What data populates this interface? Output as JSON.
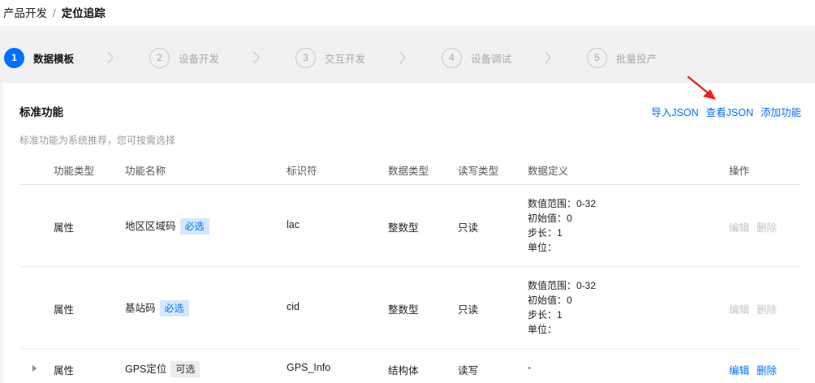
{
  "breadcrumb": {
    "parent": "产品开发",
    "separator": "/",
    "current": "定位追踪"
  },
  "steps": [
    {
      "number": "1",
      "label": "数据模板",
      "active": true
    },
    {
      "number": "2",
      "label": "设备开发",
      "active": false
    },
    {
      "number": "3",
      "label": "交互开发",
      "active": false
    },
    {
      "number": "4",
      "label": "设备调试",
      "active": false
    },
    {
      "number": "5",
      "label": "批量投产",
      "active": false
    }
  ],
  "panel": {
    "title": "标准功能",
    "description": "标准功能为系统推荐，您可按需选择",
    "actions": {
      "import_json": "导入JSON",
      "view_json": "查看JSON",
      "add_function": "添加功能"
    }
  },
  "table": {
    "headers": {
      "type": "功能类型",
      "name": "功能名称",
      "identifier": "标识符",
      "data_type": "数据类型",
      "rw_type": "读写类型",
      "definition": "数据定义",
      "operation": "操作"
    },
    "rows": [
      {
        "type": "属性",
        "name": "地区区域码",
        "tag": "必选",
        "identifier": "lac",
        "data_type": "整数型",
        "rw_type": "只读",
        "definition": [
          "数值范围：0-32",
          "初始值：0",
          "步长：1",
          "单位："
        ],
        "edit": "编辑",
        "delete": "删除"
      },
      {
        "type": "属性",
        "name": "基站码",
        "tag": "必选",
        "identifier": "cid",
        "data_type": "整数型",
        "rw_type": "只读",
        "definition": [
          "数值范围：0-32",
          "初始值：0",
          "步长：1",
          "单位："
        ],
        "edit": "编辑",
        "delete": "删除"
      },
      {
        "type": "属性",
        "name": "GPS定位",
        "tag": "可选",
        "identifier": "GPS_Info",
        "data_type": "结构体",
        "rw_type": "读写",
        "definition": [
          "-"
        ],
        "edit": "编辑",
        "delete": "删除"
      }
    ]
  },
  "colors": {
    "accent": "#006eff",
    "annotation_arrow": "#e8231a"
  }
}
